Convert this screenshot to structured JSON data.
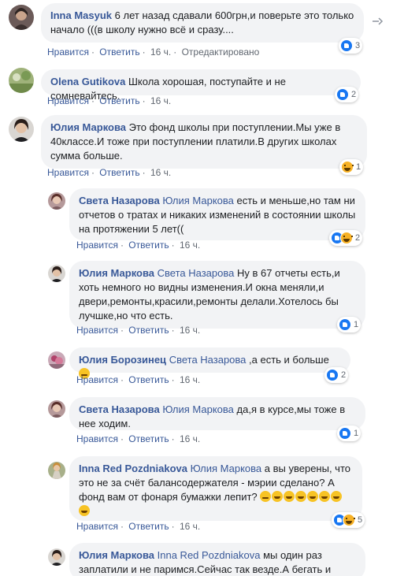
{
  "actions": {
    "like": "Нравится",
    "reply": "Ответить",
    "edited": "Отредактировано"
  },
  "comments": [
    {
      "author": "Inna Masyuk",
      "text": "6 лет назад сдавали 600грн,и поверьте это только начало (((в школу нужно всё и сразу....",
      "time": "16 ч.",
      "reactions": {
        "count": "3",
        "types": [
          "like"
        ]
      }
    },
    {
      "author": "Olena Gutikova",
      "text": "Школа хорошая, поступайте и не сомневайтесь.",
      "time": "16 ч.",
      "reactions": {
        "count": "2",
        "types": [
          "like"
        ]
      }
    },
    {
      "author": "Юлия Маркова",
      "text": "Это фонд школы при поступлении.Мы уже в 40классе.И тоже при поступлении платили.В других школах сумма больше.",
      "time": "16 ч.",
      "reactions": {
        "count": "1",
        "types": [
          "haha"
        ]
      }
    }
  ],
  "replies": [
    {
      "author": "Света Назарова",
      "mention": "Юлия Маркова",
      "text": "есть и меньше,но там ни отчетов о тратах и никаких изменений в состоянии школы на протяжении 5 лет((",
      "time": "16 ч.",
      "reactions": {
        "count": "2",
        "types": [
          "like",
          "haha"
        ]
      }
    },
    {
      "author": "Юлия Маркова",
      "mention": "Света Назарова",
      "text": "Ну в 67 отчеты есть,и хоть немного но видны изменения.И окна меняли,и двери,ремонты,красили,ремонты делали.Хотелось бы лучшке,но что есть.",
      "time": "16 ч.",
      "reactions": {
        "count": "1",
        "types": [
          "like"
        ]
      }
    },
    {
      "author": "Юлия Борозинец",
      "mention": "Света Назарова",
      "text": ",а есть и больше",
      "time": "16 ч.",
      "reactions": {
        "count": "2",
        "types": [
          "like"
        ]
      }
    },
    {
      "author": "Света Назарова",
      "mention": "Юлия Маркова",
      "text": "да,я в курсе,мы тоже в нее ходим.",
      "time": "16 ч.",
      "reactions": {
        "count": "1",
        "types": [
          "like"
        ]
      }
    },
    {
      "author": "Inna Red Pozdniakova",
      "mention": "Юлия Маркова",
      "text": "а вы уверены, что это не за счёт балансодержателя - мэрии сделано? А фонд вам от фонаря бумажки лепит?",
      "time": "16 ч.",
      "reactions": {
        "count": "5",
        "types": [
          "like",
          "haha"
        ]
      }
    },
    {
      "author": "Юлия Маркова",
      "mention": "Inna Red Pozdniakova",
      "text": "мы один раз заплатили и не паримся.Сейчас так везде.А бегать и",
      "time": "",
      "reactions": {
        "count": "",
        "types": []
      }
    }
  ],
  "colors": {
    "link": "#385898",
    "bubble": "#f2f3f5",
    "meta": "#606770",
    "like": "#1877f2",
    "haha": "#f7b125"
  }
}
